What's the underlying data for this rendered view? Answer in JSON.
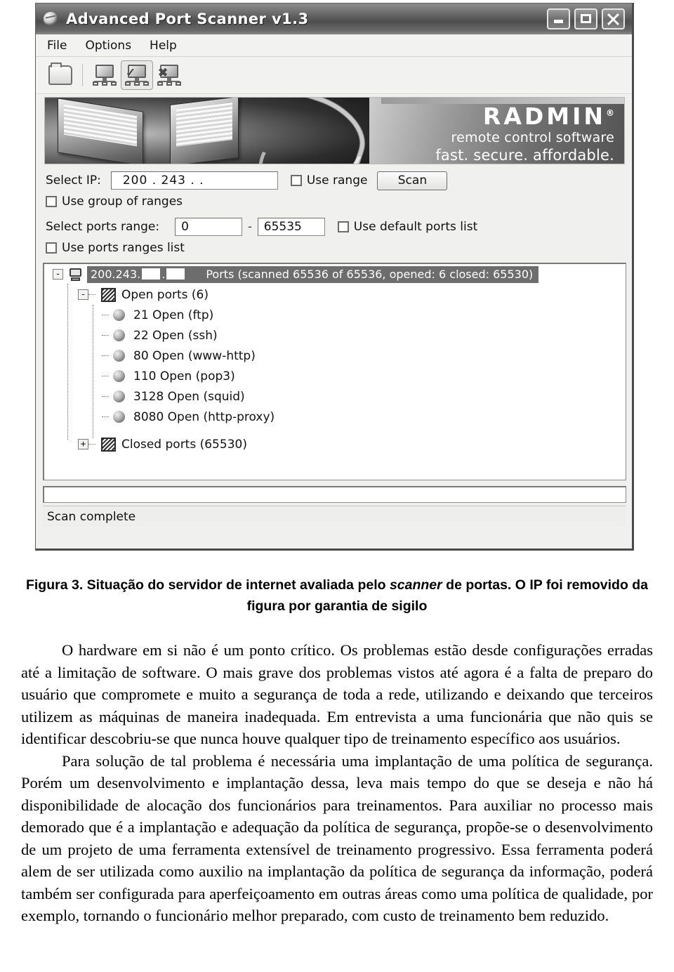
{
  "window": {
    "title": "Advanced Port Scanner v1.3",
    "title_icon": "globe-icon",
    "controls": {
      "minimize": "minimize-button",
      "maximize": "maximize-button",
      "close": "close-button"
    }
  },
  "menubar": {
    "items": [
      {
        "label": "File"
      },
      {
        "label": "Options"
      },
      {
        "label": "Help"
      }
    ]
  },
  "toolbar": {
    "buttons": [
      {
        "name": "open-folder-button",
        "icon": "folder-icon"
      },
      {
        "name": "computer-button",
        "icon": "computer-icon"
      },
      {
        "name": "scan-computer-button",
        "icon": "computer-check-icon"
      },
      {
        "name": "configure-computer-button",
        "icon": "computer-tools-icon"
      }
    ]
  },
  "banner": {
    "brand": "RADMIN",
    "trademark": "®",
    "tagline1": "remote control software",
    "tagline2": "fast. secure. affordable."
  },
  "form": {
    "select_ip_label": "Select IP:",
    "ip_value": "200 . 243 .        .",
    "use_range_label": "Use range",
    "use_range_checked": false,
    "scan_button": "Scan",
    "use_group_of_ranges_label": "Use group of ranges",
    "use_group_of_ranges_checked": false,
    "select_ports_range_label": "Select ports range:",
    "port_from": "0",
    "port_separator": "-",
    "port_to": "65535",
    "use_default_ports_list_label": "Use default ports list",
    "use_default_ports_list_checked": false,
    "use_ports_ranges_list_label": "Use ports ranges list",
    "use_ports_ranges_list_checked": false
  },
  "tree": {
    "root": {
      "ip_prefix": "200.243.",
      "summary": "Ports (scanned 65536 of 65536, opened: 6 closed: 65530)",
      "expander": "-",
      "selected": true
    },
    "open_group": {
      "label": "Open ports (6)",
      "expander": "-"
    },
    "open_ports": [
      {
        "label": "21 Open (ftp)"
      },
      {
        "label": "22 Open (ssh)"
      },
      {
        "label": "80 Open (www-http)"
      },
      {
        "label": "110 Open (pop3)"
      },
      {
        "label": "3128 Open (squid)"
      },
      {
        "label": "8080 Open (http-proxy)"
      }
    ],
    "closed_group": {
      "label": "Closed ports (65530)",
      "expander": "+"
    }
  },
  "statusbar": {
    "text": "Scan complete",
    "progress_percent": 0
  },
  "document": {
    "caption_part1": "Figura 3. Situação do servidor de internet avaliada pelo ",
    "caption_italic": "scanner",
    "caption_part2": " de portas. O IP foi removido da figura por garantia de sigilo",
    "paragraph1": "O hardware em si não é um ponto crítico. Os problemas estão desde configurações erradas até a limitação de software. O mais grave dos problemas vistos até agora é a falta de preparo do usuário que compromete e muito a segurança de toda a rede, utilizando e deixando que terceiros utilizem as máquinas de maneira inadequada. Em entrevista a uma funcionária que não quis se identificar descobriu-se que nunca houve qualquer tipo de treinamento específico aos usuários.",
    "paragraph2": "Para solução de tal problema é necessária uma implantação de uma política de segurança. Porém um desenvolvimento e implantação dessa, leva mais tempo do que se deseja e não há disponibilidade de alocação dos funcionários para treinamentos. Para auxiliar no processo mais demorado que é a implantação e adequação da política de segurança, propõe-se o desenvolvimento de um projeto de uma ferramenta extensível de treinamento progressivo. Essa ferramenta poderá alem de ser utilizada como auxilio na implantação da política de segurança da informação, poderá também ser configurada para aperfeiçoamento em outras áreas como uma política de qualidade, por exemplo, tornando o funcionário melhor preparado, com custo de treinamento bem reduzido."
  }
}
